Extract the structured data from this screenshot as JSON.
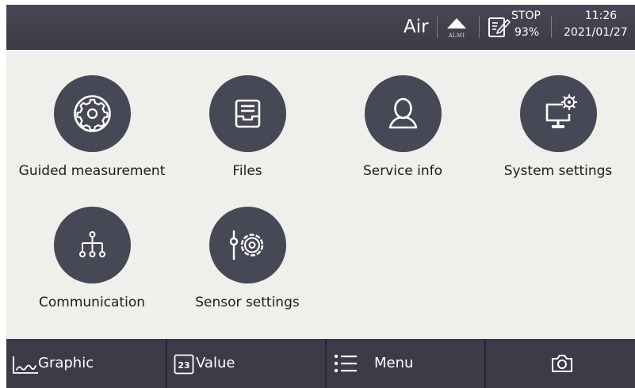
{
  "status_bar": {
    "medium": "Air",
    "alarm": {
      "icon": "triangle-up-icon",
      "label": "ALMI"
    },
    "log": {
      "icon": "edit-document-icon",
      "state": "STOP",
      "percent": "93%"
    },
    "time": "11:26",
    "date": "2021/01/27"
  },
  "tiles": [
    {
      "label": "Guided measurement",
      "icon": "gear-icon"
    },
    {
      "label": "Files",
      "icon": "inbox-tray-icon"
    },
    {
      "label": "Service info",
      "icon": "person-icon"
    },
    {
      "label": "System settings",
      "icon": "monitor-gear-icon"
    },
    {
      "label": "Communication",
      "icon": "network-tree-icon"
    },
    {
      "label": "Sensor settings",
      "icon": "sensor-gear-icon"
    }
  ],
  "bottom_bar": {
    "graphic": {
      "label": "Graphic",
      "icon": "line-graph-icon"
    },
    "value": {
      "label": "Value",
      "icon": "number-box-icon",
      "icon_text": "23"
    },
    "menu": {
      "label": "Menu",
      "icon": "list-icon"
    },
    "camera": {
      "icon": "camera-icon"
    }
  },
  "colors": {
    "bar": "#474855",
    "circle": "#474855",
    "background": "#efefeb",
    "bottom_button": "#3b3c47"
  }
}
